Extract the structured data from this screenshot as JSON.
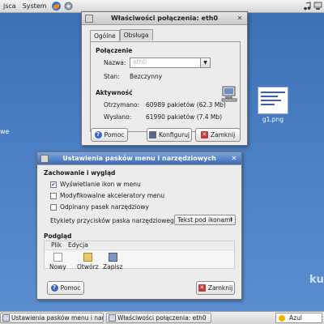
{
  "top_panel": {
    "menus": [
      "jsca",
      "System"
    ],
    "icons": [
      "firefox-icon",
      "settings-icon"
    ],
    "right_icons": [
      "music-note-icon",
      "network-icon"
    ]
  },
  "desktop": {
    "left_label": "we",
    "file_icon_label": "g1.png",
    "logo_text": "ku"
  },
  "connection_window": {
    "title": "Właściwości połączenia: eth0",
    "tabs": [
      "Ogólne",
      "Obsługa"
    ],
    "section_connection": "Połączenie",
    "name_label": "Nazwa:",
    "name_value": "eth0",
    "state_label": "Stan:",
    "state_value": "Bezczynny",
    "section_activity": "Aktywność",
    "received_label": "Otrzymano:",
    "received_value": "60989 pakietów (62.3 Mb)",
    "sent_label": "Wysłano:",
    "sent_value": "61990 pakietów (7.4 Mb)",
    "help_button": "Pomoc",
    "configure_button": "Konfiguruj",
    "close_button": "Zamknij"
  },
  "toolbar_dialog": {
    "title": "Ustawienia pasków menu i narzędziowych",
    "section_behavior": "Zachowanie i wygląd",
    "options": [
      {
        "label": "Wyświetlanie ikon w menu",
        "checked": true
      },
      {
        "label": "Modyfikowalne akceleratory menu",
        "checked": false
      },
      {
        "label": "Odpinany pasek narzędziowy",
        "checked": false
      }
    ],
    "button_labels_label": "Etykiety przycisków paska narzędziowego:",
    "button_labels_value": "Tekst pod ikonami",
    "section_preview": "Podgląd",
    "preview_menus": [
      "Plik",
      "Edycja"
    ],
    "preview_items": [
      "Nowy",
      "Otwórz",
      "Zapisz"
    ],
    "help_button": "Pomoc",
    "close_button": "Zamknij"
  },
  "taskbar": {
    "tasks": [
      "Ustawienia pasków menu i narzędziowych",
      "Właściwości połączenia: eth0"
    ],
    "weather": "Azul"
  },
  "colors": {
    "desktop": "#4a7fc4",
    "active_title": "#3d6ab3",
    "help_icon": "#3a64c0",
    "close_icon": "#c03a3a"
  }
}
